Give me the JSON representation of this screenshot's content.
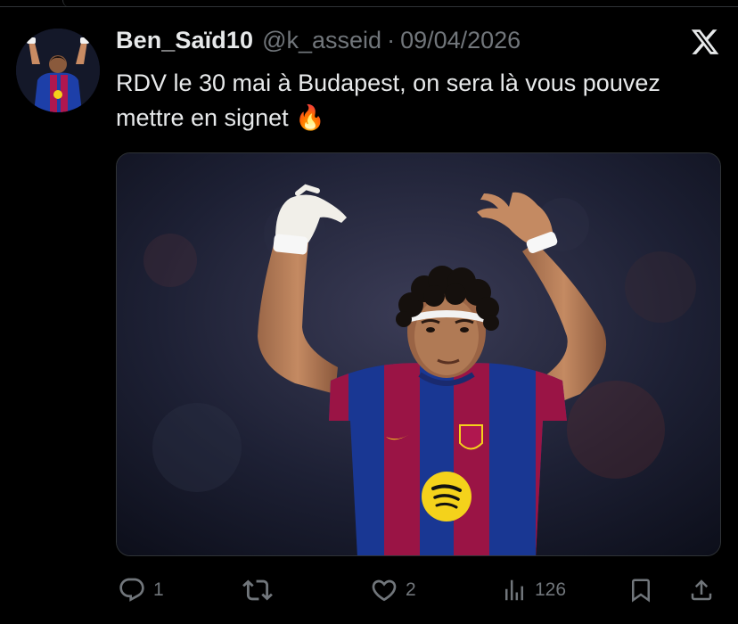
{
  "tweet": {
    "display_name": "Ben_Saïd10",
    "handle": "@k_asseid",
    "separator": "·",
    "date": "09/04/2026",
    "text": "RDV le 30 mai à Budapest, on sera là vous pouvez mettre en signet 🔥"
  },
  "actions": {
    "replies": "1",
    "retweets": "",
    "likes": "2",
    "views": "126"
  },
  "icons": {
    "close": "x-logo-icon",
    "reply": "reply-icon",
    "retweet": "retweet-icon",
    "like": "heart-icon",
    "views": "views-icon",
    "bookmark": "bookmark-icon",
    "share": "share-icon"
  },
  "colors": {
    "background": "#000000",
    "text": "#e7e9ea",
    "muted": "#71767b",
    "kit_blue": "#1d3fa8",
    "kit_garnet": "#b0174f"
  }
}
